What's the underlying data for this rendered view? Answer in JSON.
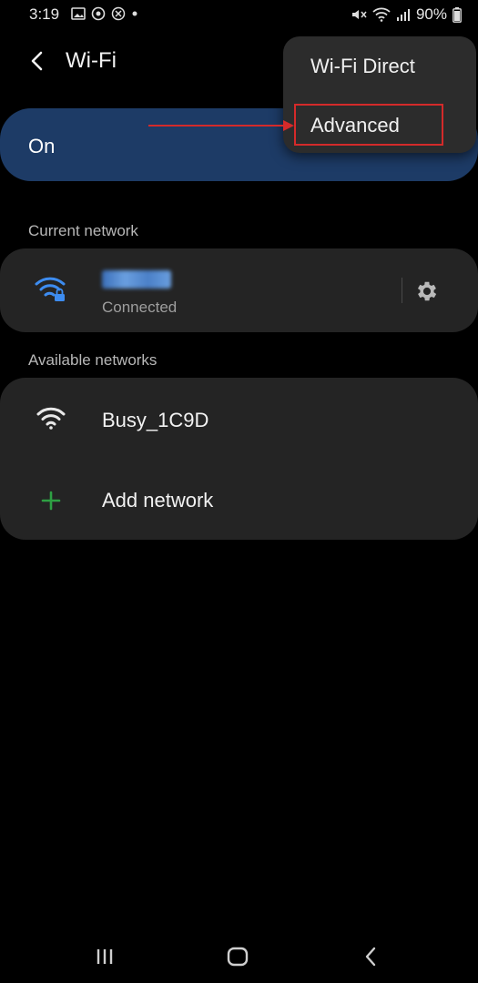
{
  "status_bar": {
    "time": "3:19",
    "battery": "90%"
  },
  "header": {
    "title": "Wi-Fi"
  },
  "toggle": {
    "label": "On"
  },
  "current_network": {
    "heading": "Current network",
    "status": "Connected"
  },
  "available_networks": {
    "heading": "Available networks",
    "items": [
      {
        "name": "Busy_1C9D"
      }
    ],
    "add_label": "Add network"
  },
  "popup_menu": {
    "items": [
      {
        "label": "Wi-Fi Direct"
      },
      {
        "label": "Advanced"
      }
    ]
  },
  "colors": {
    "toggle_bg": "#1d3b66",
    "accent_blue": "#3d8cf0",
    "add_green": "#2ea043",
    "highlight_red": "#d42a2a"
  }
}
